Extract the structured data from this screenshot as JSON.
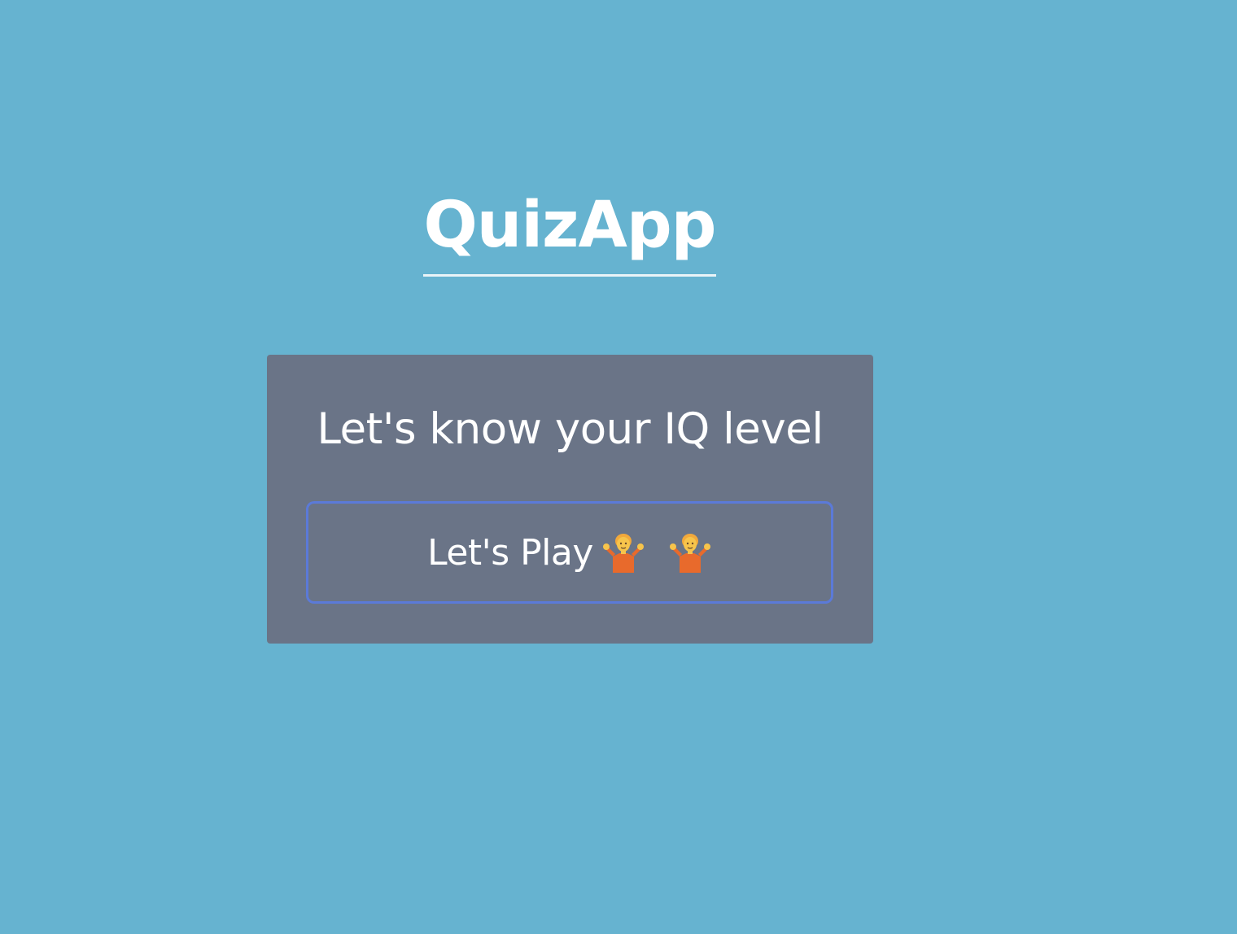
{
  "app": {
    "title": "QuizApp"
  },
  "card": {
    "heading": "Let's know your IQ level",
    "play_button": {
      "label": "Let's Play",
      "icons": [
        "person-shrugging-icon",
        "person-shrugging-icon"
      ]
    }
  },
  "colors": {
    "background": "#66b3d0",
    "card": "#6a7487",
    "button_border": "#5b7ad8",
    "text": "#ffffff"
  }
}
